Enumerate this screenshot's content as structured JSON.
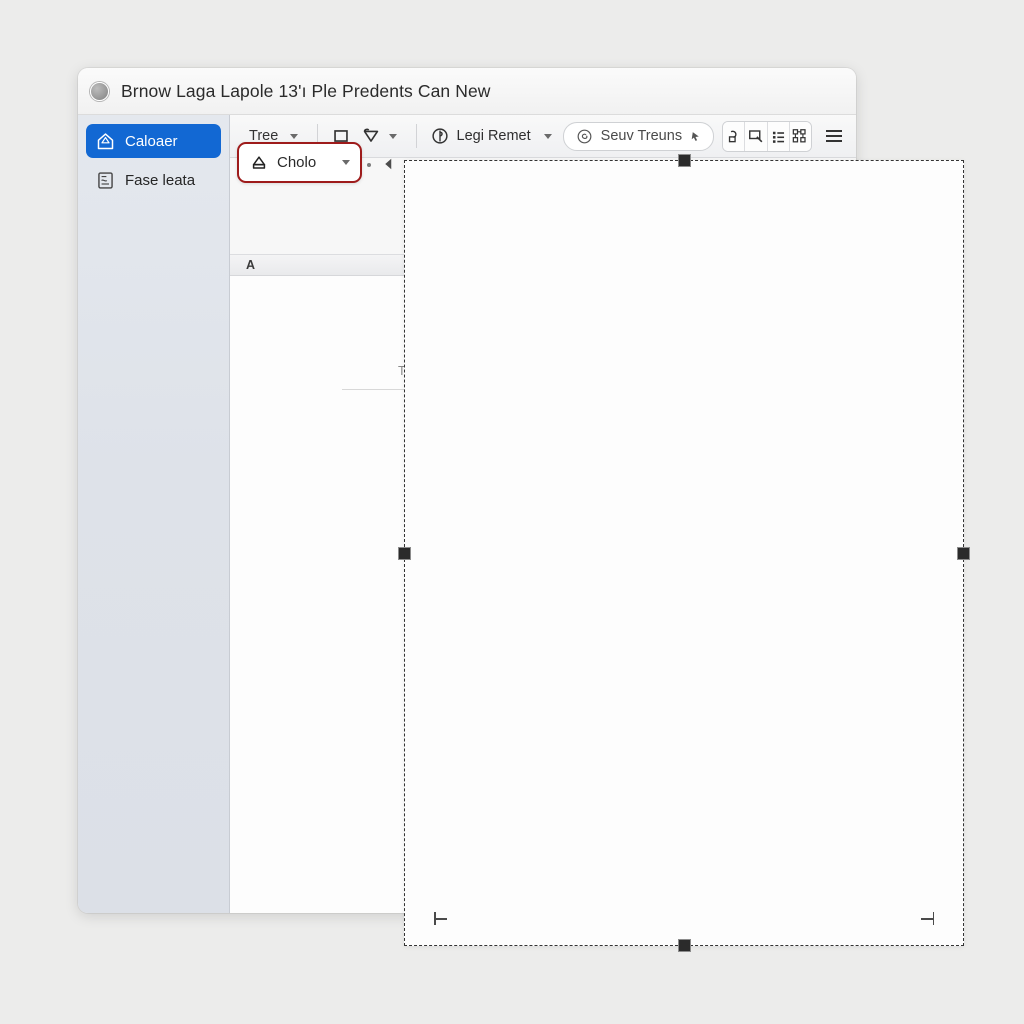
{
  "window": {
    "title": "Brnow Laga Lapole 13'ı Ple Predents Can New",
    "orb_icon": "circle-orb-icon"
  },
  "sidebar": {
    "items": [
      {
        "label": "Caloaer",
        "icon": "home-shield-icon",
        "selected": true
      },
      {
        "label": "Fase leata",
        "icon": "document-page-icon",
        "selected": false
      }
    ]
  },
  "toolbar": {
    "tree_label": "Tree",
    "shape_rect_icon": "square-shape-icon",
    "shape_shield_icon": "shield-shape-icon",
    "legi_remet": {
      "label": "Legi Remet",
      "icon": "target-circle-icon"
    },
    "seuv_treuns": {
      "label": "Seuv Treuns",
      "icon": "spiral-circle-icon",
      "trailing_icon": "cursor-arrow-icon"
    },
    "segment_buttons": [
      {
        "icon": "link-break-icon"
      },
      {
        "icon": "comment-bubble-icon"
      },
      {
        "icon": "list-lines-icon"
      },
      {
        "icon": "flowchart-nodes-icon"
      }
    ],
    "menu_icon": "hamburger-menu-icon"
  },
  "shape_combo": {
    "icon": "home-outline-icon",
    "label": "Cholo",
    "caret_icon": "chevron-down-icon",
    "border_color": "#9e1b1b"
  },
  "collapse_control": {
    "dot_icon": "dot-separator-icon",
    "arrow_icon": "triangle-left-icon"
  },
  "sub_row": {
    "label": "A"
  },
  "document": {
    "heading": "The Drem ?ky",
    "rule_icon": "horizontal-rule-divider"
  },
  "selection": {
    "handles": [
      "top-handle",
      "bottom-handle",
      "left-handle",
      "right-handle"
    ],
    "crop_marks": [
      "bottom-left-crop-mark",
      "bottom-right-crop-mark"
    ],
    "border_style": "dashed"
  },
  "colors": {
    "accent": "#1268d3",
    "highlight_border": "#9e1b1b",
    "background": "#ececeb",
    "sidebar": "#dee2e9"
  }
}
